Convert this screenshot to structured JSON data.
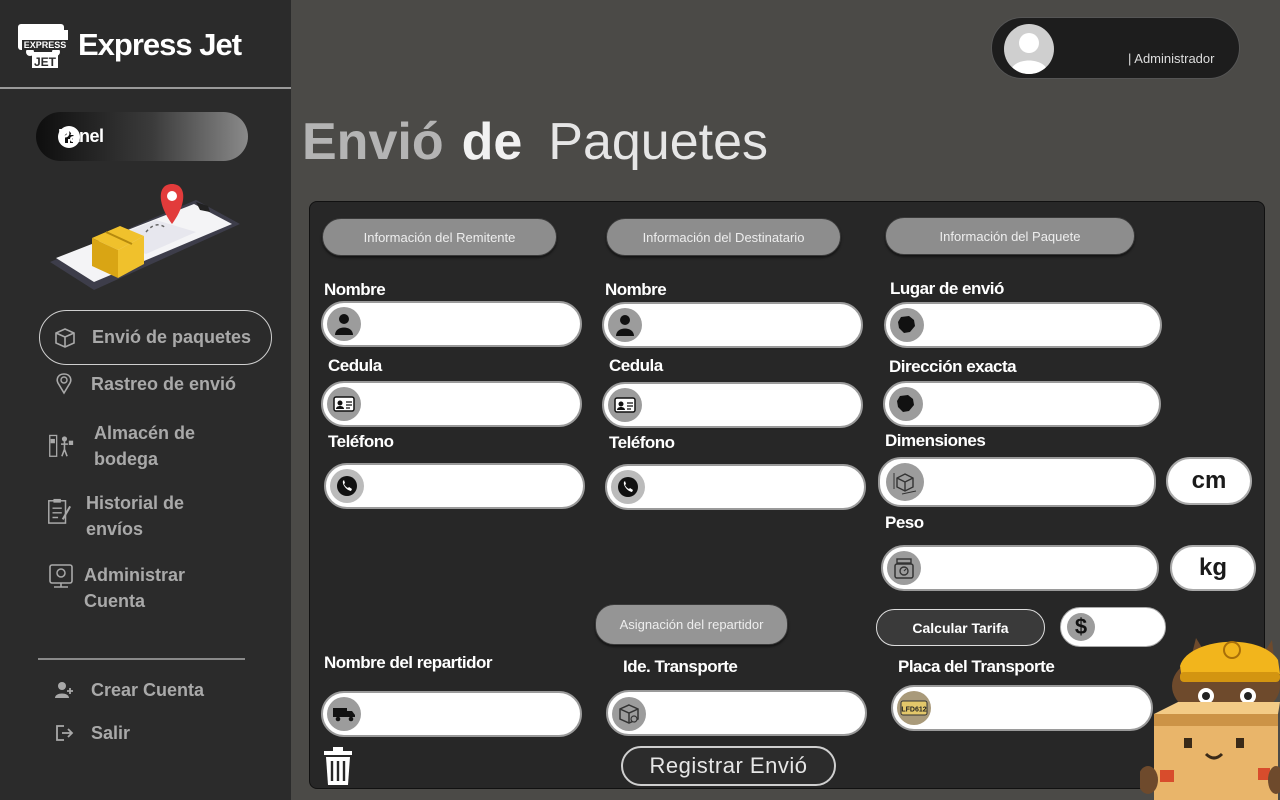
{
  "brand": {
    "name": "Express Jet",
    "logo_text_top": "EXPRESS",
    "logo_text_bottom": "JET"
  },
  "sidebar": {
    "panel_label": "Panel",
    "items": [
      {
        "label": "Envió de paquetes",
        "icon": "package-icon",
        "active": true
      },
      {
        "label": "Rastreo de envió",
        "icon": "location-pin-icon"
      },
      {
        "label": "Almacén de bodega",
        "icon": "warehouse-icon"
      },
      {
        "label": "Historial de envíos",
        "icon": "clipboard-icon"
      },
      {
        "label": "Administrar Cuenta",
        "icon": "account-settings-icon"
      }
    ],
    "bottom": [
      {
        "label": "Crear Cuenta",
        "icon": "add-user-icon"
      },
      {
        "label": "Salir",
        "icon": "logout-icon"
      }
    ]
  },
  "header": {
    "role": "| Administrador"
  },
  "title": {
    "word1": "Envió",
    "word2": "de",
    "word3": "Paquetes"
  },
  "sections": {
    "sender": "Información  del Remitente",
    "recipient": "Información  del Destinatario",
    "package": "Información  del Paquete",
    "courier": "Asignación del repartidor"
  },
  "labels": {
    "sender_name": "Nombre",
    "sender_id": "Cedula",
    "sender_phone": "Teléfono",
    "recipient_name": "Nombre",
    "recipient_id": "Cedula",
    "recipient_phone": "Teléfono",
    "ship_place": "Lugar de envió",
    "exact_address": "Dirección exacta",
    "dimensions": "Dimensiones",
    "weight": "Peso",
    "courier_name": "Nombre del repartidor",
    "transport_id": "Ide. Transporte",
    "transport_plate": "Placa del Transporte"
  },
  "units": {
    "dimensions": "cm",
    "weight": "kg",
    "currency": "$"
  },
  "plate_icon_text": "LFD612",
  "buttons": {
    "calculate": "Calcular Tarifa",
    "register": "Registrar Envió"
  },
  "colors": {
    "sidebar": "#2b2b2b",
    "background": "#4b4a47",
    "card": "#272727",
    "pill": "#8d8d8d"
  }
}
